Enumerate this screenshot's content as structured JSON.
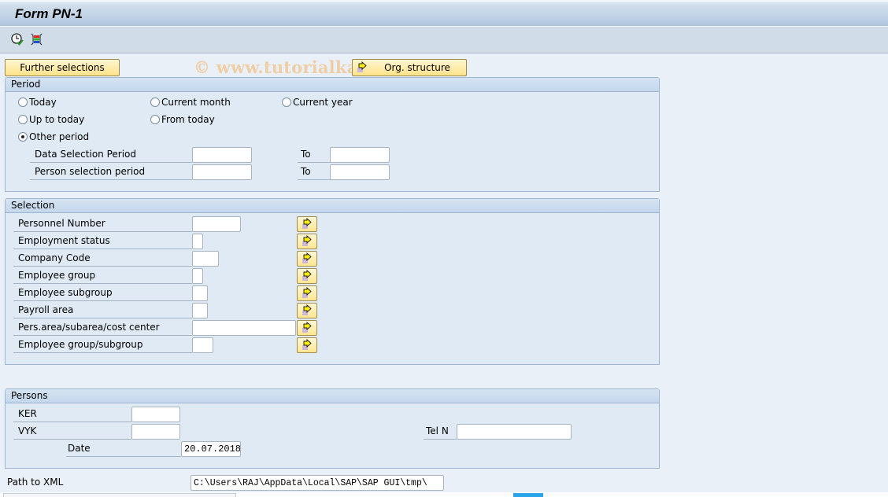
{
  "window": {
    "title": "Form PN-1",
    "watermark": "© www.tutorialkart.com"
  },
  "toolbar": {
    "icons": [
      {
        "name": "execute-clock-icon",
        "tooltip": ""
      },
      {
        "name": "selection-options-icon",
        "tooltip": ""
      }
    ]
  },
  "buttons": {
    "further_selections": "Further selections",
    "org_structure": "Org. structure"
  },
  "period": {
    "header": "Period",
    "radios": [
      {
        "label": "Today",
        "checked": false
      },
      {
        "label": "Current month",
        "checked": false
      },
      {
        "label": "Current year",
        "checked": false
      },
      {
        "label": "Up to today",
        "checked": false
      },
      {
        "label": "From today",
        "checked": false
      },
      {
        "label": "Other period",
        "checked": true
      }
    ],
    "rows": [
      {
        "label": "Data Selection Period",
        "from": "",
        "to_label": "To",
        "to": ""
      },
      {
        "label": "Person selection period",
        "from": "",
        "to_label": "To",
        "to": ""
      }
    ]
  },
  "selection": {
    "header": "Selection",
    "fields": [
      {
        "label": "Personnel Number",
        "value": ""
      },
      {
        "label": "Employment status",
        "value": ""
      },
      {
        "label": "Company Code",
        "value": ""
      },
      {
        "label": "Employee group",
        "value": ""
      },
      {
        "label": "Employee subgroup",
        "value": ""
      },
      {
        "label": "Payroll area",
        "value": ""
      },
      {
        "label": "Pers.area/subarea/cost center",
        "value": ""
      },
      {
        "label": "Employee group/subgroup",
        "value": ""
      }
    ]
  },
  "persons": {
    "header": "Persons",
    "ker_label": "KER",
    "ker_value": "",
    "vyk_label": "VYK",
    "vyk_value": "",
    "date_label": "Date",
    "date_value": "20.07.2018",
    "tel_label": "Tel N",
    "tel_value": ""
  },
  "path": {
    "label": "Path to XML",
    "value": "C:\\Users\\RAJ\\AppData\\Local\\SAP\\SAP GUI\\tmp\\"
  },
  "colors": {
    "button_yellow": "#ffe38a",
    "group_bg": "#dfeaf4",
    "header_blue": "#c3d7ec",
    "page_bg": "#eaf0f7"
  }
}
